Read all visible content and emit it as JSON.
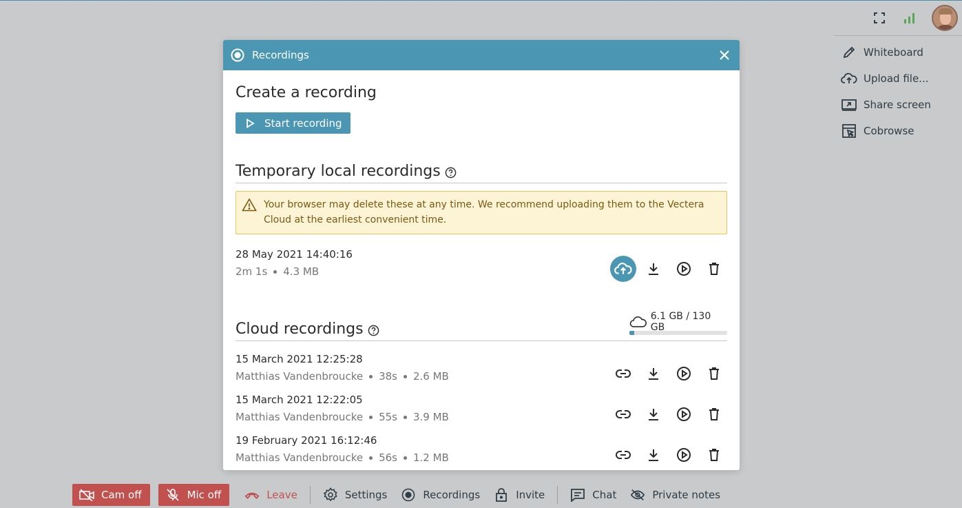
{
  "right_panel": {
    "items": [
      {
        "label": "Whiteboard",
        "icon": "pencil-icon"
      },
      {
        "label": "Upload file...",
        "icon": "cloud-upload-icon"
      },
      {
        "label": "Share screen",
        "icon": "share-screen-icon"
      },
      {
        "label": "Cobrowse",
        "icon": "cobrowse-icon"
      }
    ]
  },
  "toolbar": {
    "cam_label": "Cam off",
    "mic_label": "Mic off",
    "leave_label": "Leave",
    "settings_label": "Settings",
    "recordings_label": "Recordings",
    "invite_label": "Invite",
    "chat_label": "Chat",
    "notes_label": "Private notes"
  },
  "modal": {
    "title": "Recordings",
    "create_heading": "Create a recording",
    "start_button": "Start recording",
    "temp_heading": "Temporary local recordings",
    "warning": "Your browser may delete these at any time. We recommend uploading them to the Vectera Cloud at the earliest convenient time.",
    "local_recordings": [
      {
        "date": "28 May 2021 14:40:16",
        "duration": "2m 1s",
        "size": "4.3 MB"
      }
    ],
    "cloud_heading": "Cloud recordings",
    "cloud_usage": {
      "text": "6.1 GB / 130 GB",
      "used_fraction": 0.047
    },
    "cloud_recordings": [
      {
        "date": "15 March 2021 12:25:28",
        "author": "Matthias Vandenbroucke",
        "duration": "38s",
        "size": "2.6 MB"
      },
      {
        "date": "15 March 2021 12:22:05",
        "author": "Matthias Vandenbroucke",
        "duration": "55s",
        "size": "3.9 MB"
      },
      {
        "date": "19 February 2021 16:12:46",
        "author": "Matthias Vandenbroucke",
        "duration": "56s",
        "size": "1.2 MB"
      }
    ]
  },
  "colors": {
    "accent": "#4b96b3",
    "danger": "#c0514f",
    "warning_bg": "#fdf3d5"
  }
}
